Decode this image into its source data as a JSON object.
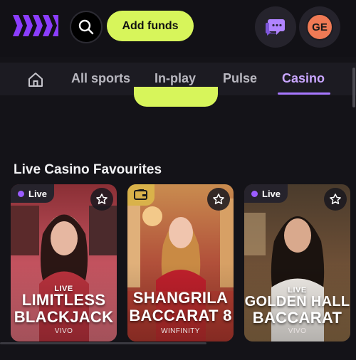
{
  "header": {
    "add_funds_label": "Add funds",
    "avatar_initials": "GE"
  },
  "nav": {
    "tabs": [
      {
        "label": "All sports"
      },
      {
        "label": "In-play"
      },
      {
        "label": "Pulse"
      },
      {
        "label": "Casino",
        "active": true
      }
    ]
  },
  "section": {
    "title": "Live Casino Favourites"
  },
  "cards": [
    {
      "badge": "Live",
      "line1": "LIVE",
      "line2": "LIMITLESS",
      "line3": "BLACKJACK",
      "provider": "VIVO"
    },
    {
      "badge": "",
      "line1": "",
      "line2": "SHANGRILA",
      "line3": "BACCARAT 8",
      "provider": "WINFINITY"
    },
    {
      "badge": "Live",
      "line1": "LIVE",
      "line2": "GOLDEN HALL",
      "line3": "BACCARAT",
      "provider": "VIVO"
    }
  ],
  "colors": {
    "accent_lime": "#d7f55b",
    "accent_purple": "#a777ff",
    "avatar_orange": "#f07a55"
  }
}
